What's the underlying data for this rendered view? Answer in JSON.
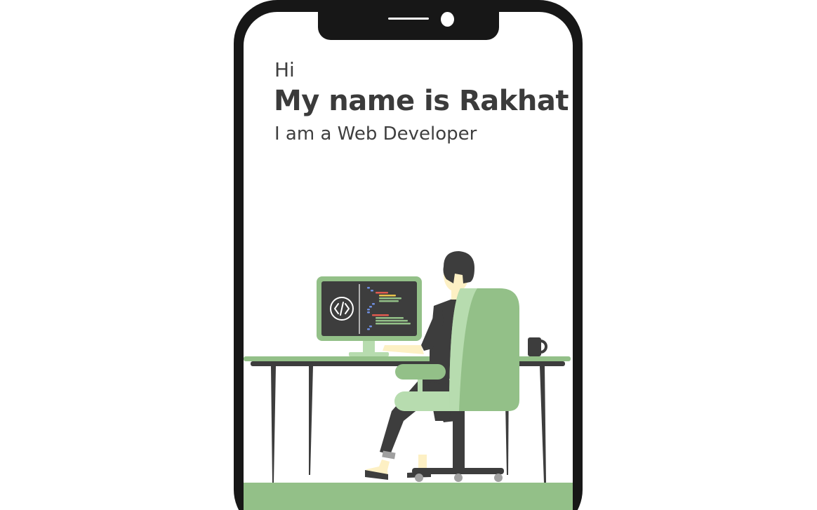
{
  "hero": {
    "greeting": "Hi",
    "name_heading": "My name is Rakhat",
    "role": "I am a Web Developer"
  },
  "colors": {
    "frame": "#171717",
    "screen": "#ffffff",
    "text": "#3f3f3f",
    "accent_green": "#93c088",
    "light_green": "#b7dcaf",
    "dark_gray": "#3d3d3d",
    "skin": "#fdf0c4"
  },
  "icons": {
    "code": "code-icon",
    "camera": "front-camera-icon",
    "speaker": "speaker-icon",
    "mug": "coffee-mug-icon"
  }
}
